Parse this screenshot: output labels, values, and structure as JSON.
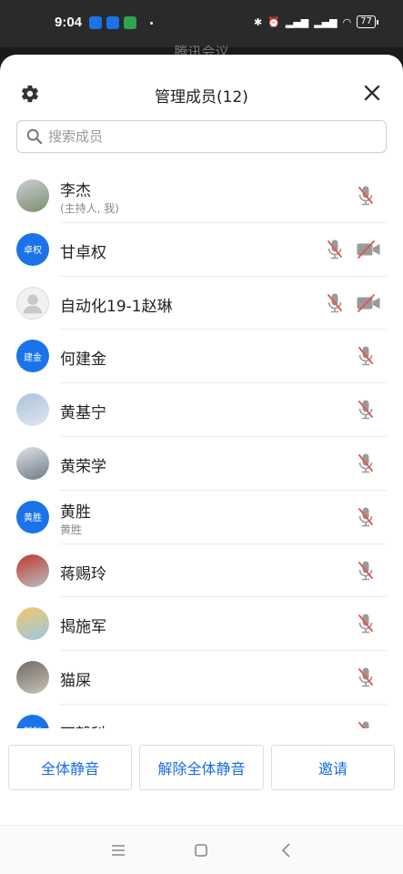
{
  "status_bar": {
    "time": "9:04",
    "battery": "77",
    "app_icons": [
      "#1a73e8",
      "#1a73e8",
      "#2ea44f"
    ]
  },
  "behind_title": "腾讯会议",
  "header": {
    "title": "管理成员(12)"
  },
  "search": {
    "placeholder": "搜索成员"
  },
  "participants": [
    {
      "name": "李杰",
      "subtitle": "(主持人, 我)",
      "avatar": "photo",
      "avatar_colors": [
        "#7a8f6b",
        "#c9cfd6"
      ],
      "mic": "muted",
      "camera": null
    },
    {
      "name": "甘卓权",
      "subtitle": "",
      "avatar": "initial",
      "initial": "卓权",
      "mic": "muted",
      "camera": "off"
    },
    {
      "name": "自动化19-1赵琳",
      "subtitle": "",
      "avatar": "default",
      "mic": "muted",
      "camera": "off"
    },
    {
      "name": "何建金",
      "subtitle": "",
      "avatar": "initial",
      "initial": "建金",
      "mic": "muted",
      "camera": null
    },
    {
      "name": "黄基宁",
      "subtitle": "",
      "avatar": "photo",
      "avatar_colors": [
        "#dfe7ee",
        "#a9c3d9"
      ],
      "mic": "muted",
      "camera": null
    },
    {
      "name": "黄荣学",
      "subtitle": "",
      "avatar": "photo",
      "avatar_colors": [
        "#6d7a86",
        "#dfe3e6"
      ],
      "mic": "muted",
      "camera": null
    },
    {
      "name": "黄胜",
      "subtitle": "黄胜",
      "avatar": "initial",
      "initial": "黄胜",
      "mic": "muted",
      "camera": null
    },
    {
      "name": "蒋赐玲",
      "subtitle": "",
      "avatar": "photo",
      "avatar_colors": [
        "#b9bfc4",
        "#c0392b"
      ],
      "mic": "muted",
      "camera": null
    },
    {
      "name": "揭施军",
      "subtitle": "",
      "avatar": "photo",
      "avatar_colors": [
        "#9bc7e6",
        "#f1c86a"
      ],
      "mic": "muted",
      "camera": null
    },
    {
      "name": "猫屎",
      "subtitle": "",
      "avatar": "photo",
      "avatar_colors": [
        "#c9c3b8",
        "#6f6a63"
      ],
      "mic": "muted",
      "camera": null
    },
    {
      "name": "石毅科",
      "subtitle": "",
      "avatar": "initial",
      "initial": "毅科",
      "mic": "muted",
      "camera": null
    }
  ],
  "buttons": {
    "mute_all": "全体静音",
    "unmute_all": "解除全体静音",
    "invite": "邀请"
  },
  "colors": {
    "accent": "#1a6be0",
    "muted_red": "#e05555"
  }
}
